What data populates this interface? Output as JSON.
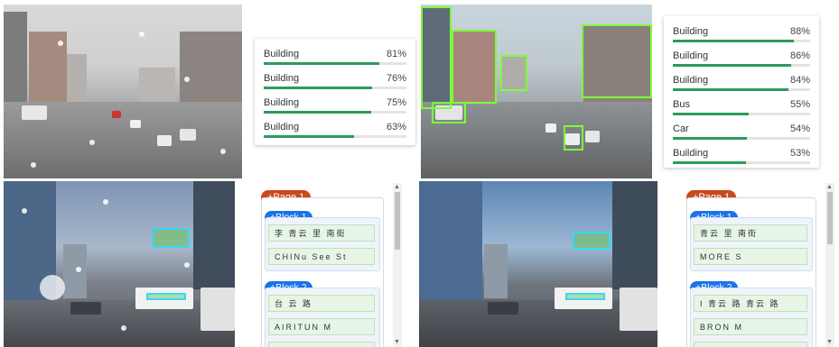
{
  "panels": [
    {
      "id": "top-left",
      "labels": [
        {
          "label": "Building",
          "score": "81%",
          "value": 0.81
        },
        {
          "label": "Building",
          "score": "76%",
          "value": 0.76
        },
        {
          "label": "Building",
          "score": "75%",
          "value": 0.75
        },
        {
          "label": "Building",
          "score": "63%",
          "value": 0.63
        }
      ]
    },
    {
      "id": "top-right",
      "labels": [
        {
          "label": "Building",
          "score": "88%",
          "value": 0.88
        },
        {
          "label": "Building",
          "score": "86%",
          "value": 0.86
        },
        {
          "label": "Building",
          "score": "84%",
          "value": 0.84
        },
        {
          "label": "Bus",
          "score": "55%",
          "value": 0.55
        },
        {
          "label": "Car",
          "score": "54%",
          "value": 0.54
        },
        {
          "label": "Building",
          "score": "53%",
          "value": 0.53
        }
      ]
    }
  ],
  "ocr": [
    {
      "id": "bottom-left",
      "page_label": "+Page 1",
      "blocks": [
        {
          "label": "+Block 1",
          "lines": [
            "李 青云 里 南街",
            "CHINu See St"
          ]
        },
        {
          "label": "+Block 2",
          "lines": [
            "台 云 路",
            "AIRITUN M"
          ]
        }
      ]
    },
    {
      "id": "bottom-right",
      "page_label": "+Page 1",
      "blocks": [
        {
          "label": "+Block 1",
          "lines": [
            "青云 里 南街",
            "MORE S"
          ]
        },
        {
          "label": "+Block 2",
          "lines": [
            "I 青云 路 青云 路",
            "BRON M"
          ]
        }
      ]
    }
  ],
  "colors": {
    "bar": "#2e9a5c",
    "page_pill": "#c94a1c",
    "block_pill": "#1a73e8",
    "detect_box": "#7cff3a"
  },
  "scroll_icons": {
    "up": "▲",
    "down": "▼"
  }
}
